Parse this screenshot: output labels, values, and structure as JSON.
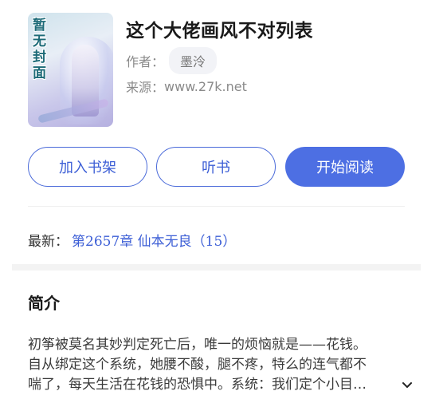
{
  "book": {
    "cover_text": "暂无封面",
    "title": "这个大佬画风不对列表",
    "author_label": "作者：",
    "author": "墨泠",
    "source_label": "来源：",
    "source": "www.27k.net"
  },
  "actions": {
    "add_shelf": "加入书架",
    "listen": "听书",
    "start_reading": "开始阅读"
  },
  "latest": {
    "label": "最新：",
    "chapter": "第2657章 仙本无良（15）"
  },
  "intro": {
    "heading": "简介",
    "lines": [
      "初筝被莫名其妙判定死亡后，唯一的烦恼就是——花钱。",
      "自从绑定这个系统，她腰不酸，腿不疼，特么的连气都不",
      "喘了，每天生活在花钱的恐惧中。系统：我们定个小目…"
    ]
  },
  "colors": {
    "accent": "#4d6fe3",
    "link": "#3d5fd6"
  }
}
